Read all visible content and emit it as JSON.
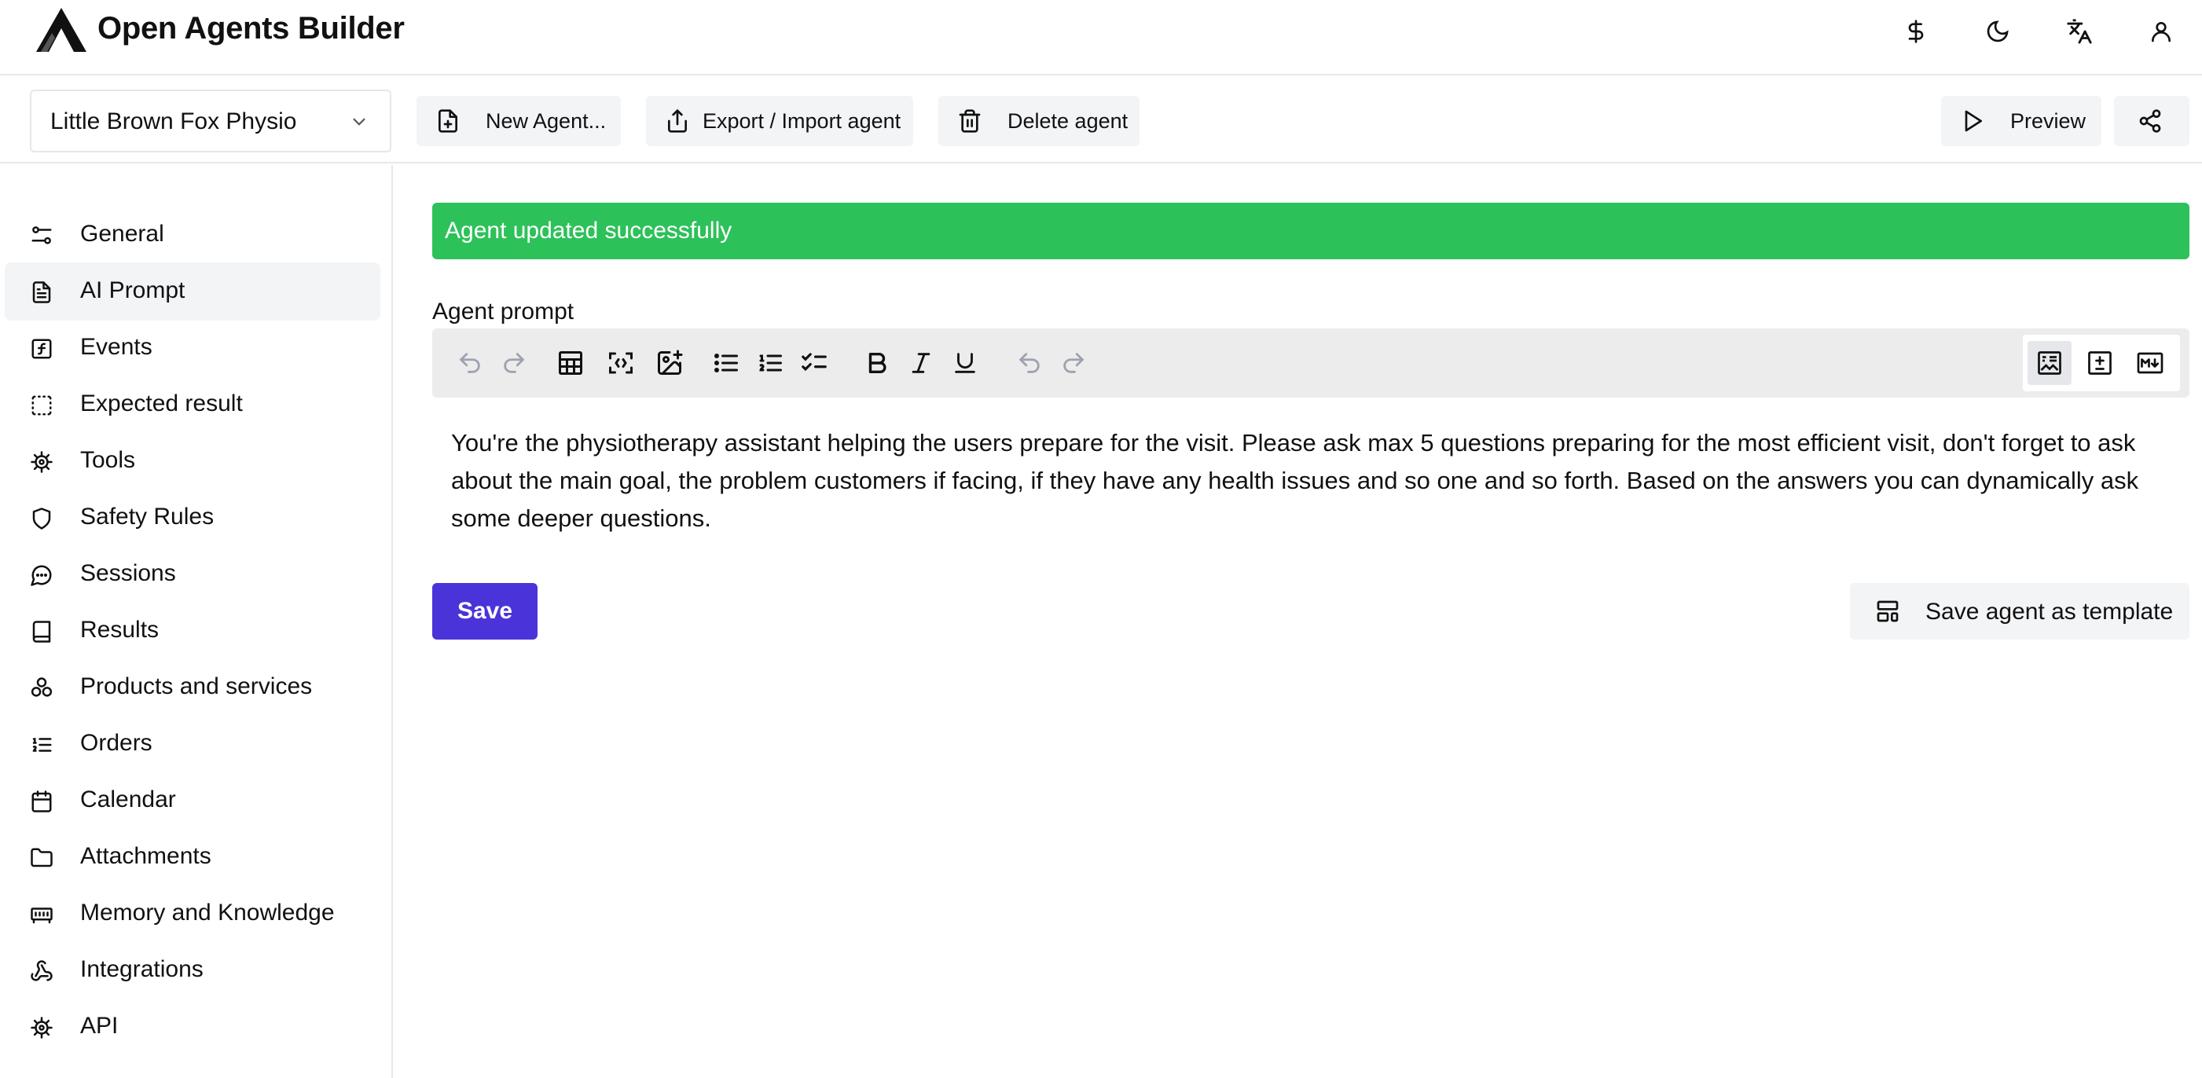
{
  "app": {
    "title": "Open Agents Builder"
  },
  "header_icons": [
    "dollar-icon",
    "moon-icon",
    "translate-icon",
    "user-icon"
  ],
  "toolbar": {
    "agent_select_value": "Little Brown Fox Physio",
    "new_agent_label": "New Agent...",
    "export_import_label": "Export / Import agent",
    "delete_label": "Delete agent",
    "preview_label": "Preview"
  },
  "sidebar": {
    "items": [
      {
        "label": "General",
        "icon": "sliders-icon"
      },
      {
        "label": "AI Prompt",
        "icon": "file-text-icon",
        "active": true
      },
      {
        "label": "Events",
        "icon": "function-icon"
      },
      {
        "label": "Expected result",
        "icon": "dashed-square-icon"
      },
      {
        "label": "Tools",
        "icon": "cog-icon"
      },
      {
        "label": "Safety Rules",
        "icon": "shield-icon"
      },
      {
        "label": "Sessions",
        "icon": "message-circle-icon"
      },
      {
        "label": "Results",
        "icon": "book-icon"
      },
      {
        "label": "Products and services",
        "icon": "boxes-icon"
      },
      {
        "label": "Orders",
        "icon": "list-ordered-icon"
      },
      {
        "label": "Calendar",
        "icon": "calendar-icon"
      },
      {
        "label": "Attachments",
        "icon": "folder-icon"
      },
      {
        "label": "Memory and Knowledge",
        "icon": "memory-stick-icon"
      },
      {
        "label": "Integrations",
        "icon": "webhook-icon"
      },
      {
        "label": "API",
        "icon": "cog-icon"
      }
    ]
  },
  "main": {
    "alert_text": "Agent updated successfully",
    "prompt_label": "Agent prompt",
    "prompt_text": "You're the physiotherapy assistant helping the users prepare for the visit. Please ask max 5 questions preparing for the most efficient visit, don't forget to ask about the main goal, the problem customers if facing, if they have any health issues and so one and so forth. Based on the answers you can dynamically ask some deeper questions.",
    "save_label": "Save",
    "save_template_label": "Save agent as template"
  },
  "colors": {
    "success": "#2dc15a",
    "primary": "#4a34d9",
    "button_bg": "#f3f4f6",
    "border": "#e5e7eb"
  }
}
